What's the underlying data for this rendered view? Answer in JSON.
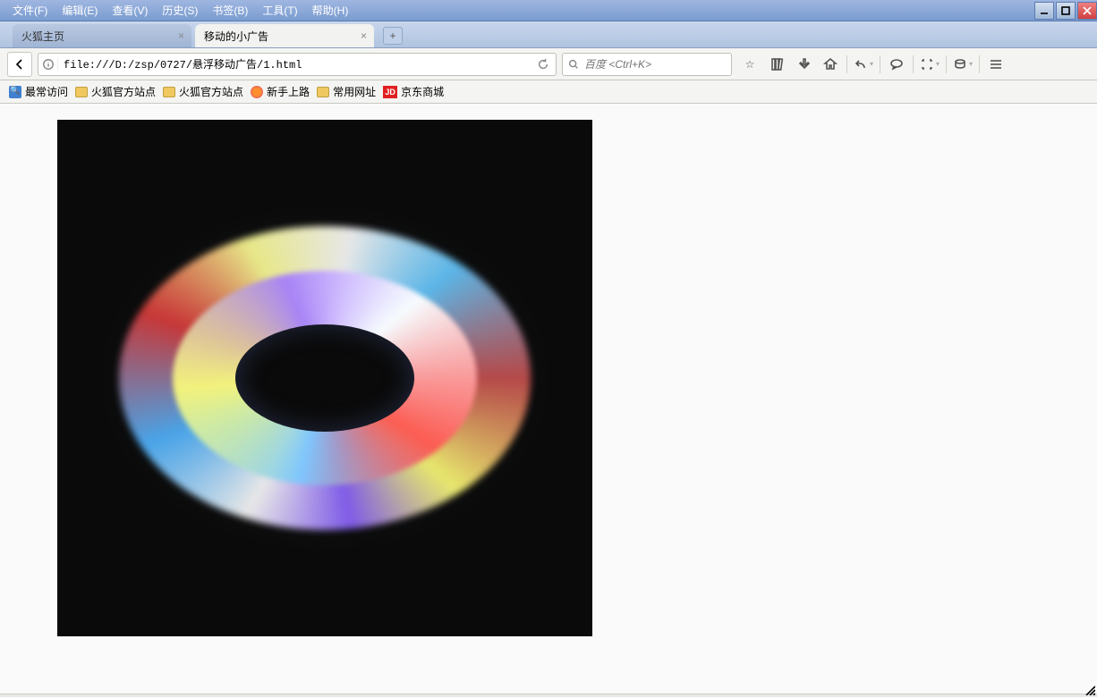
{
  "menus": {
    "file": "文件(F)",
    "edit": "编辑(E)",
    "view": "查看(V)",
    "history": "历史(S)",
    "bookmarks": "书签(B)",
    "tools": "工具(T)",
    "help": "帮助(H)"
  },
  "tabs": {
    "inactive_title": "火狐主页",
    "active_title": "移动的小广告"
  },
  "url": {
    "value": "file:///D:/zsp/0727/悬浮移动广告/1.html"
  },
  "search": {
    "placeholder": "百度 <Ctrl+K>"
  },
  "bookmarks": {
    "most_visited": "最常访问",
    "firefox_sites": "火狐官方站点",
    "firefox_sites2": "火狐官方站点",
    "newbie": "新手上路",
    "common_sites": "常用网址",
    "jd_label": "京东商城",
    "jd_badge": "JD"
  }
}
